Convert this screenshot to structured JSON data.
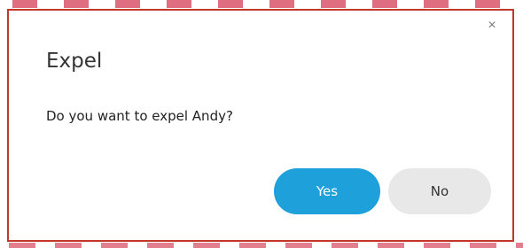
{
  "dialog": {
    "title": "Expel",
    "message": "Do you want to expel Andy?",
    "close_glyph": "×",
    "buttons": {
      "yes_label": "Yes",
      "no_label": "No"
    }
  },
  "colors": {
    "primary_button": "#1ea0da",
    "secondary_button": "#e8e8e8",
    "border_accent": "#c0392b"
  },
  "icons": {
    "close": "close-icon"
  }
}
